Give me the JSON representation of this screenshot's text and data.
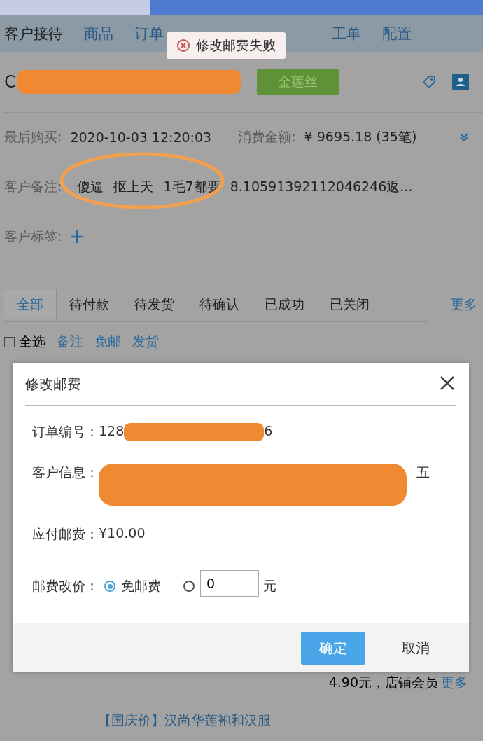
{
  "nav": {
    "items": [
      {
        "label": "客户接待",
        "selected": true
      },
      {
        "label": "商品",
        "selected": false
      },
      {
        "label": "订单",
        "selected": false
      },
      {
        "label": "工单",
        "selected": false
      },
      {
        "label": "配置",
        "selected": false
      }
    ]
  },
  "toast": {
    "text": "修改邮费失败"
  },
  "customer": {
    "name_start": "C",
    "badge": "金莲丝",
    "last_purchase": {
      "label": "最后购买:",
      "value": "2020-10-03 12:20:03"
    },
    "spend": {
      "label": "消费金额:",
      "value": "¥ 9695.18 (35笔)"
    },
    "note": {
      "label": "客户备注:",
      "value": "傻逼 抠上天 1毛7都要 8.10591392112046246返..."
    },
    "tags": {
      "label": "客户标签:"
    }
  },
  "order_tabs": [
    {
      "label": "全部",
      "selected": true
    },
    {
      "label": "待付款",
      "selected": false
    },
    {
      "label": "待发货",
      "selected": false
    },
    {
      "label": "待确认",
      "selected": false
    },
    {
      "label": "已成功",
      "selected": false
    },
    {
      "label": "已关闭",
      "selected": false
    }
  ],
  "more_tab": "更多",
  "actions": {
    "select_all": {
      "label": "全选",
      "checked": false
    },
    "links": [
      "备注",
      "免邮",
      "发货"
    ]
  },
  "modal": {
    "title": "修改邮费",
    "order_no": {
      "label": "订单编号：",
      "value_start": "128",
      "value_end": "6"
    },
    "customer_info": {
      "label": "客户信息：",
      "value_end": "五"
    },
    "postage": {
      "label": "应付邮费：",
      "value": "¥10.00"
    },
    "change": {
      "label": "邮费改价：",
      "options": [
        {
          "kind": "preset",
          "label": "免邮费",
          "selected": true
        },
        {
          "kind": "custom",
          "selected": false,
          "value": "0",
          "unit": "元"
        }
      ]
    },
    "buttons": [
      {
        "kind": "primary",
        "label": "确定"
      },
      {
        "kind": "plain",
        "label": "取消"
      }
    ]
  },
  "behind": {
    "summary": "4.90元，店铺会员",
    "more": "更多",
    "product": "【国庆价】汉尚华莲袍和汉服"
  }
}
